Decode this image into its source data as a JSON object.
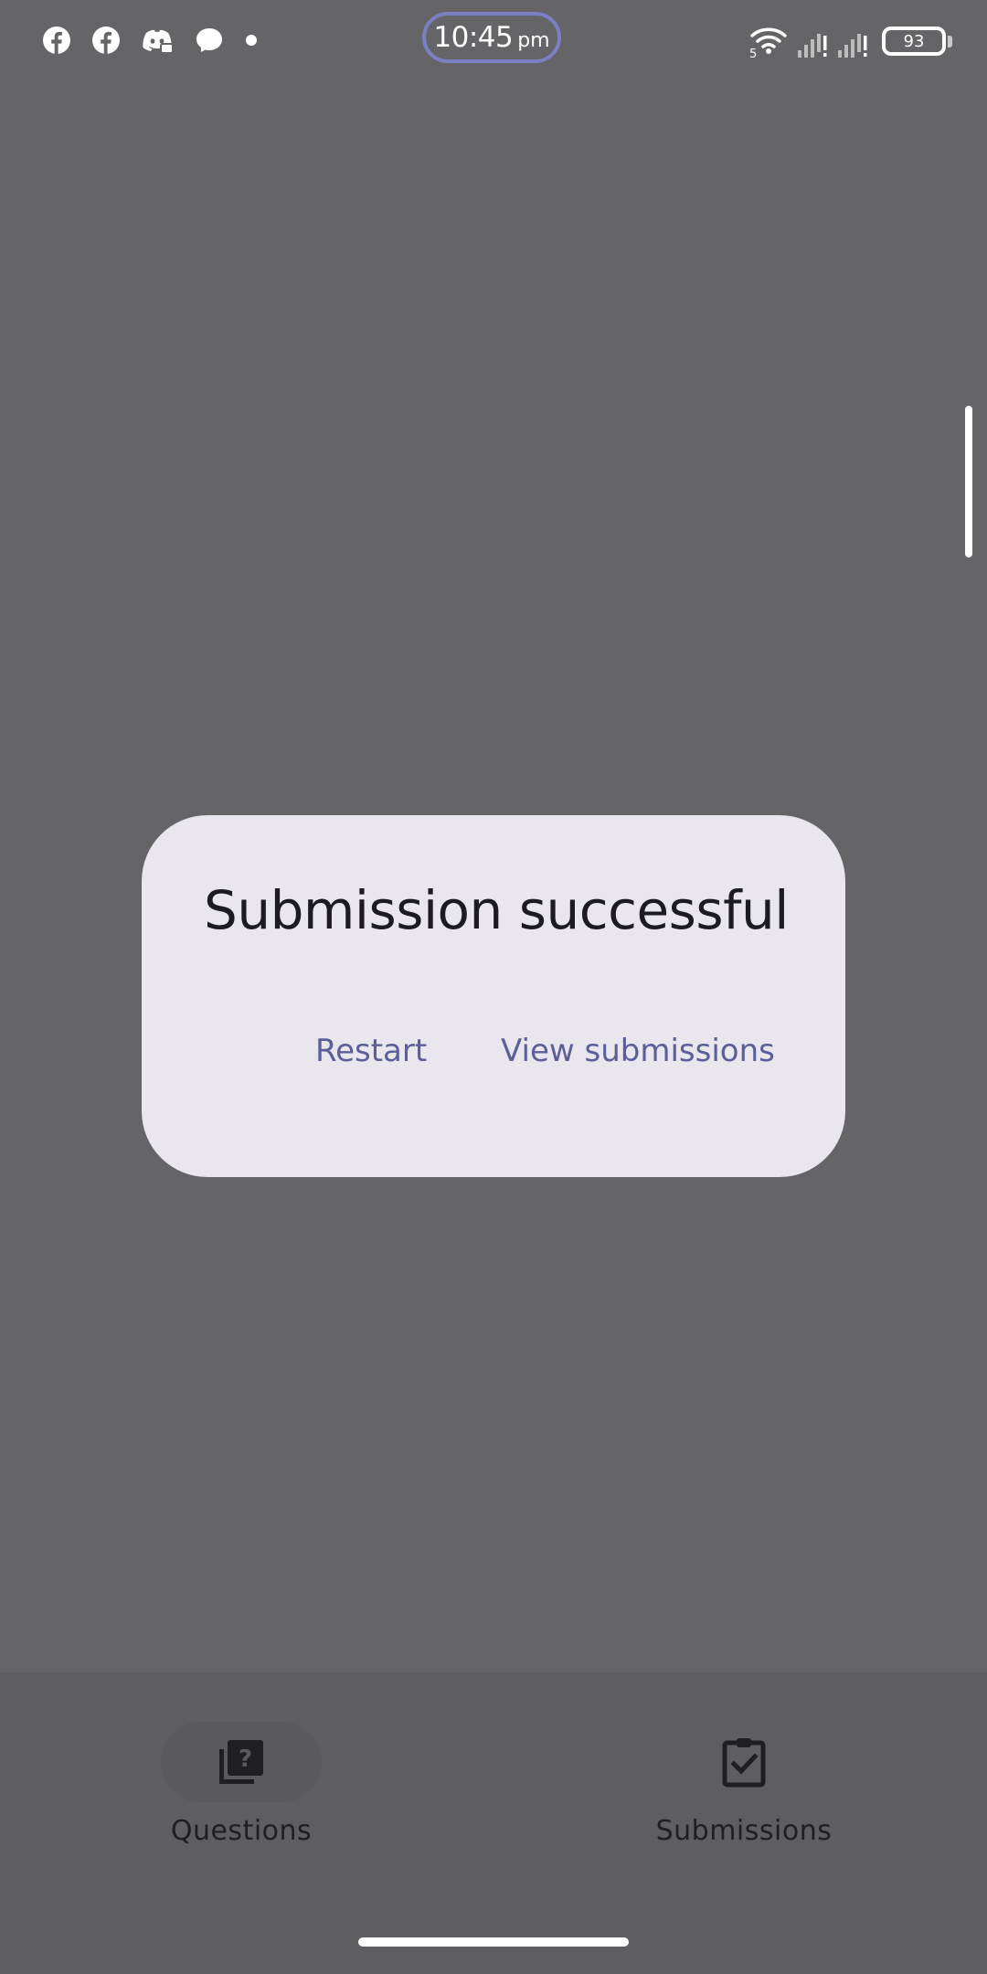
{
  "status_bar": {
    "time": "10:45",
    "ampm": "pm",
    "battery": "93",
    "network_label": "5",
    "notification_icons": [
      "facebook-icon",
      "facebook-icon",
      "discord-icon",
      "messenger-icon",
      "more-notifications-dot"
    ],
    "accent_color": "#7b80c4"
  },
  "dialog": {
    "title": "Submission successful",
    "buttons": {
      "restart": "Restart",
      "view_submissions": "View submissions"
    },
    "button_color": "#5a5f9a"
  },
  "bottom_nav": {
    "items": [
      {
        "label": "Questions",
        "icon": "quiz-icon",
        "selected": true
      },
      {
        "label": "Submissions",
        "icon": "assignment-check-icon",
        "selected": false
      }
    ]
  }
}
